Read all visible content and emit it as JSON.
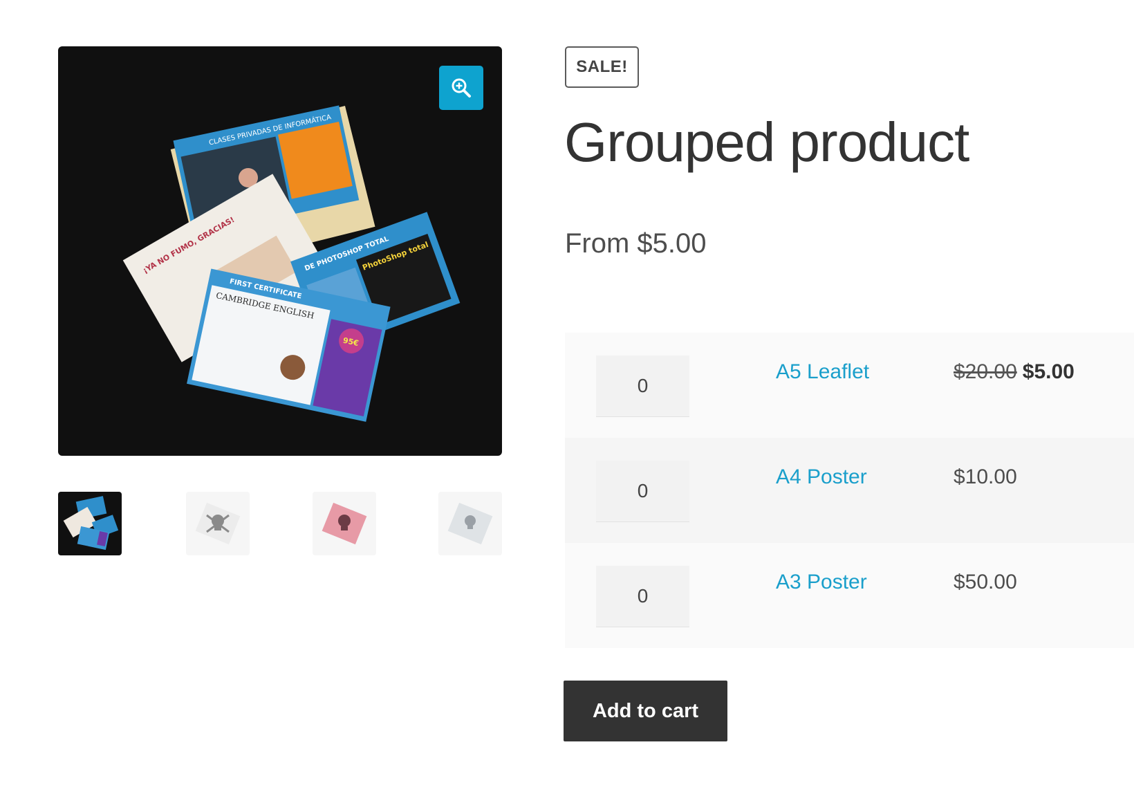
{
  "gallery": {
    "zoom_icon": "zoom-in-icon",
    "image_text": {
      "card1_header": "CLASES PRIVADAS DE INFORMÁTICA",
      "card2_header": "¡YA NO FUMO, GRACIAS!",
      "card3_header": "DE PHOTOSHOP TOTAL",
      "card3_sub": "PhotoShop total",
      "card4_header": "FIRST CERTIFICATE",
      "card4_title": "CAMBRIDGE ENGLISH",
      "card4_price": "95€"
    },
    "thumbnails": [
      {
        "icon": "flyers-thumbnail",
        "active": true
      },
      {
        "icon": "skull-thumbnail",
        "active": false
      },
      {
        "icon": "pink-skull-thumbnail",
        "active": false
      },
      {
        "icon": "grey-skull-thumbnail",
        "active": false
      }
    ]
  },
  "product": {
    "badge": "SALE!",
    "title": "Grouped product",
    "price_range": "From $5.00"
  },
  "grouped_items": [
    {
      "qty": "0",
      "name": "A5 Leaflet",
      "regular_price": "$20.00",
      "sale_price": "$5.00"
    },
    {
      "qty": "0",
      "name": "A4 Poster",
      "price": "$10.00"
    },
    {
      "qty": "0",
      "name": "A3 Poster",
      "price": "$50.00"
    }
  ],
  "actions": {
    "add_to_cart_label": "Add to cart"
  },
  "colors": {
    "accent": "#0ea3cf",
    "link": "#1a9fcb",
    "button": "#333333"
  }
}
